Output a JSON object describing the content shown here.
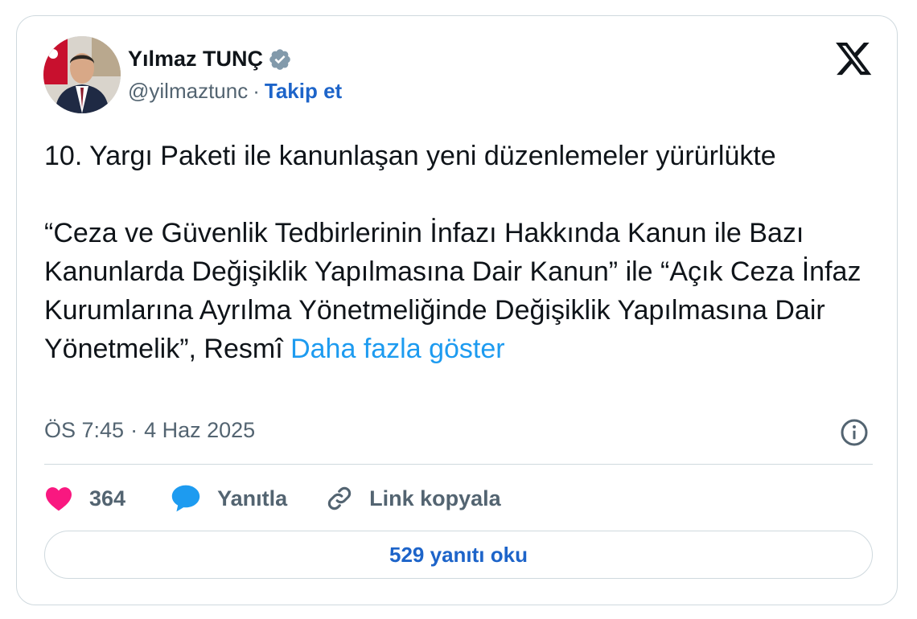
{
  "author": {
    "name": "Yılmaz TUNÇ",
    "handle": "@yilmaztunc",
    "follow_label": "Takip et",
    "verified_icon": "verified-badge-icon"
  },
  "tweet": {
    "line1": "10. Yargı Paketi ile kanunlaşan yeni düzenlemeler yürürlükte",
    "line2": "“Ceza ve Güvenlik Tedbirlerinin İnfazı Hakkında Kanun ile Bazı Kanunlarda Değişiklik Yapılmasına Dair Kanun” ile “Açık Ceza İnfaz Kurumlarına Ayrılma Yönetmeliğinde Değişiklik Yapılmasına Dair Yönetmelik”, Resmî",
    "show_more": "Daha fazla göster"
  },
  "meta": {
    "time": "ÖS 7:45",
    "date": "4 Haz 2025",
    "separator": "·"
  },
  "actions": {
    "like_count": "364",
    "reply_label": "Yanıtla",
    "copy_label": "Link kopyala"
  },
  "read_replies_label": "529 yanıtı oku",
  "colors": {
    "link": "#1d9bf0",
    "follow": "#1d64c9",
    "heart": "#f91880",
    "reply_bubble": "#1d9bf0",
    "muted": "#536471",
    "border": "#cfd9de"
  }
}
